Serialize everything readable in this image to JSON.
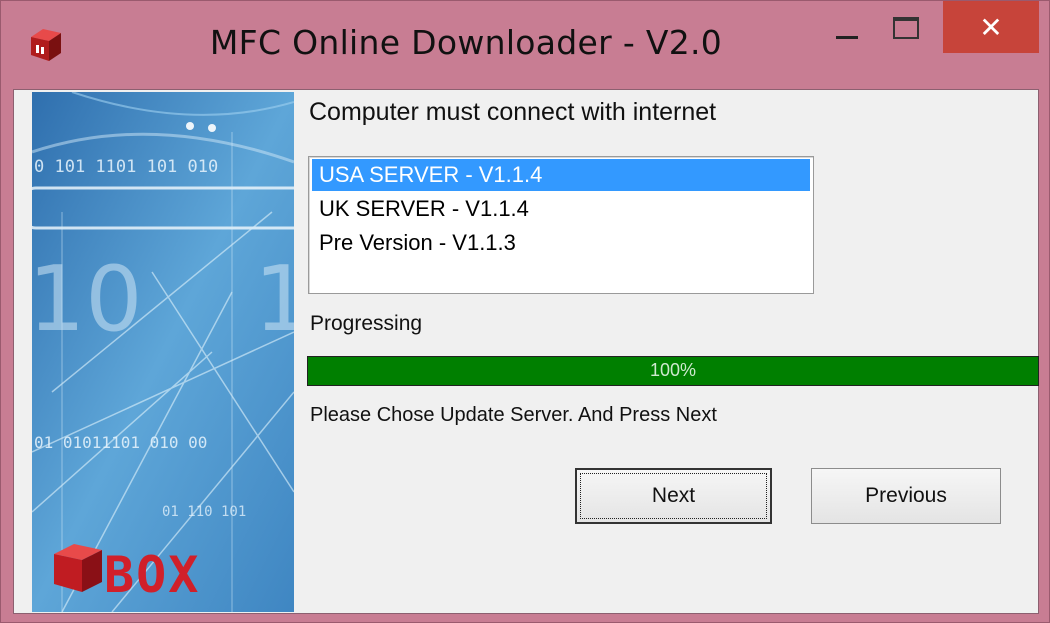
{
  "window": {
    "title": "MFC Online Downloader - V2.0",
    "close_glyph": "✕",
    "icons": [
      "app-icon",
      "minimize-icon",
      "maximize-icon",
      "close-icon"
    ]
  },
  "banner": {
    "brand": "BOX",
    "binary_texts": [
      "0 101 1101 101 010",
      "10",
      "1",
      "01 01011101 010 00",
      "01 110 101"
    ]
  },
  "main": {
    "heading": "Computer must connect with internet",
    "servers": [
      {
        "label": "USA SERVER - V1.1.4",
        "selected": true
      },
      {
        "label": "UK SERVER - V1.1.4",
        "selected": false
      },
      {
        "label": "Pre Version - V1.1.3",
        "selected": false
      }
    ],
    "progress_label": "Progressing",
    "progress_percent": 100,
    "progress_text": "100%",
    "status": "Please Chose Update Server. And Press Next",
    "buttons": {
      "next": "Next",
      "previous": "Previous"
    }
  },
  "colors": {
    "titlebar": "#c87d93",
    "close": "#c7443a",
    "selection": "#3399ff",
    "progress": "#007f00",
    "banner": "#4a90c9",
    "brand": "#d0202a"
  }
}
